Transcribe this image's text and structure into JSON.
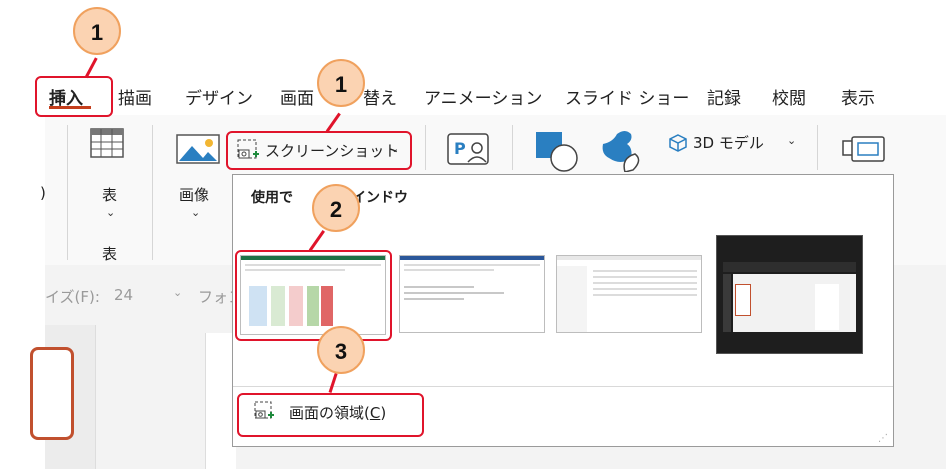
{
  "callouts": {
    "c1a": "1",
    "c1b": "1",
    "c2": "2",
    "c3": "3"
  },
  "tabs": [
    "挿入",
    "描画",
    "デザイン",
    "画面切り替え",
    "アニメーション",
    "スライド ショー",
    "記録",
    "校閲",
    "表示"
  ],
  "tab_visible": {
    "insert": "挿入",
    "draw": "描画",
    "design": "デザイン",
    "transitions_part1": "画面",
    "transitions_part2": "替え",
    "animations": "アニメーション",
    "slideshow": "スライド ショー",
    "record": "記録",
    "review": "校閲",
    "view": "表示"
  },
  "ribbon": {
    "table_label": "表",
    "table_group": "表",
    "images_label": "画像",
    "screenshot_label": "スクリーンショット",
    "model3d_label": "3D モデル",
    "left_partial": ")",
    "font_size_label": "イズ(F):",
    "font_size_value": "24",
    "font_label": "フォン"
  },
  "panel": {
    "heading_part1": "使用で",
    "heading_part2": "インドウ",
    "clip_label": "画面の領域(",
    "clip_key": "C",
    "clip_end": ")"
  },
  "colors": {
    "accent_red": "#e0142b",
    "callout_fill": "#fbd3b2",
    "callout_border": "#f0a15e"
  }
}
